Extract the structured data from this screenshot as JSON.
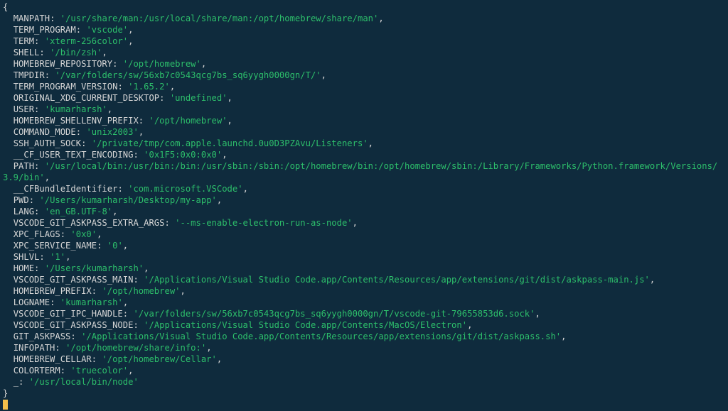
{
  "open_brace": "{",
  "close_brace": "}",
  "indent": "  ",
  "colon_sep": ": ",
  "comma": ",",
  "wrap_prefix": "",
  "entries": [
    {
      "key": "MANPATH",
      "value": "'/usr/share/man:/usr/local/share/man:/opt/homebrew/share/man'"
    },
    {
      "key": "TERM_PROGRAM",
      "value": "'vscode'"
    },
    {
      "key": "TERM",
      "value": "'xterm-256color'"
    },
    {
      "key": "SHELL",
      "value": "'/bin/zsh'"
    },
    {
      "key": "HOMEBREW_REPOSITORY",
      "value": "'/opt/homebrew'"
    },
    {
      "key": "TMPDIR",
      "value": "'/var/folders/sw/56xb7c0543qcg7bs_sq6yygh0000gn/T/'"
    },
    {
      "key": "TERM_PROGRAM_VERSION",
      "value": "'1.65.2'"
    },
    {
      "key": "ORIGINAL_XDG_CURRENT_DESKTOP",
      "value": "'undefined'"
    },
    {
      "key": "USER",
      "value": "'kumarharsh'"
    },
    {
      "key": "HOMEBREW_SHELLENV_PREFIX",
      "value": "'/opt/homebrew'"
    },
    {
      "key": "COMMAND_MODE",
      "value": "'unix2003'"
    },
    {
      "key": "SSH_AUTH_SOCK",
      "value": "'/private/tmp/com.apple.launchd.0u0D3PZAvu/Listeners'"
    },
    {
      "key": "__CF_USER_TEXT_ENCODING",
      "value": "'0x1F5:0x0:0x0'"
    },
    {
      "key": "PATH",
      "value": "'/usr/local/bin:/usr/bin:/bin:/usr/sbin:/sbin:/opt/homebrew/bin:/opt/homebrew/sbin:/Library/Frameworks/Python.framework/Versions/3.9/bin'"
    },
    {
      "key": "__CFBundleIdentifier",
      "value": "'com.microsoft.VSCode'"
    },
    {
      "key": "PWD",
      "value": "'/Users/kumarharsh/Desktop/my-app'"
    },
    {
      "key": "LANG",
      "value": "'en_GB.UTF-8'"
    },
    {
      "key": "VSCODE_GIT_ASKPASS_EXTRA_ARGS",
      "value": "'--ms-enable-electron-run-as-node'"
    },
    {
      "key": "XPC_FLAGS",
      "value": "'0x0'"
    },
    {
      "key": "XPC_SERVICE_NAME",
      "value": "'0'"
    },
    {
      "key": "SHLVL",
      "value": "'1'"
    },
    {
      "key": "HOME",
      "value": "'/Users/kumarharsh'"
    },
    {
      "key": "VSCODE_GIT_ASKPASS_MAIN",
      "value": "'/Applications/Visual Studio Code.app/Contents/Resources/app/extensions/git/dist/askpass-main.js'"
    },
    {
      "key": "HOMEBREW_PREFIX",
      "value": "'/opt/homebrew'"
    },
    {
      "key": "LOGNAME",
      "value": "'kumarharsh'"
    },
    {
      "key": "VSCODE_GIT_IPC_HANDLE",
      "value": "'/var/folders/sw/56xb7c0543qcg7bs_sq6yygh0000gn/T/vscode-git-79655853d6.sock'"
    },
    {
      "key": "VSCODE_GIT_ASKPASS_NODE",
      "value": "'/Applications/Visual Studio Code.app/Contents/MacOS/Electron'"
    },
    {
      "key": "GIT_ASKPASS",
      "value": "'/Applications/Visual Studio Code.app/Contents/Resources/app/extensions/git/dist/askpass.sh'"
    },
    {
      "key": "INFOPATH",
      "value": "'/opt/homebrew/share/info:'"
    },
    {
      "key": "HOMEBREW_CELLAR",
      "value": "'/opt/homebrew/Cellar'"
    },
    {
      "key": "COLORTERM",
      "value": "'truecolor'"
    },
    {
      "key": "_",
      "value": "'/usr/local/bin/node'"
    }
  ]
}
